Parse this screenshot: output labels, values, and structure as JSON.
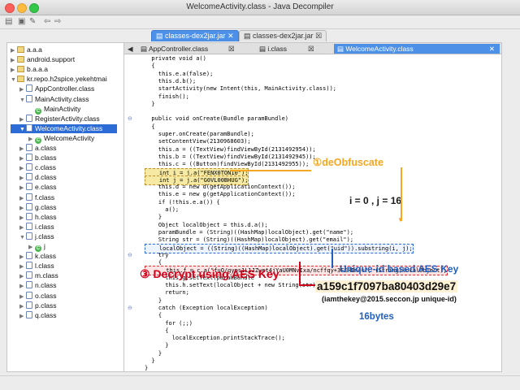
{
  "window": {
    "title": "WelcomeActivity.class - Java Decompiler"
  },
  "file_tabs": [
    {
      "label": "classes-dex2jar.jar",
      "close": "✕"
    },
    {
      "label": "classes-dex2jar.jar",
      "close": "☒"
    }
  ],
  "tree": [
    {
      "label": "a.a.a",
      "icon": "package",
      "arrow": "▶"
    },
    {
      "label": "android.support",
      "icon": "package",
      "arrow": "▶"
    },
    {
      "label": "b.a.a.a",
      "icon": "package",
      "arrow": "▶"
    },
    {
      "label": "kr.repo.h2spice.yekehtmai",
      "icon": "package",
      "arrow": "▼"
    },
    {
      "label": "AppController.class",
      "icon": "class",
      "arrow": "▶"
    },
    {
      "label": "MainActivity.class",
      "icon": "class",
      "arrow": "▼"
    },
    {
      "label": "MainActivity",
      "icon": "c",
      "arrow": ""
    },
    {
      "label": "RegisterActivity.class",
      "icon": "class",
      "arrow": "▶"
    },
    {
      "label": "WelcomeActivity.class",
      "icon": "class",
      "arrow": "▼"
    },
    {
      "label": "WelcomeActivity",
      "icon": "c",
      "arrow": "▶"
    },
    {
      "label": "a.class",
      "icon": "class",
      "arrow": "▶"
    },
    {
      "label": "b.class",
      "icon": "class",
      "arrow": "▶"
    },
    {
      "label": "c.class",
      "icon": "class",
      "arrow": "▶"
    },
    {
      "label": "d.class",
      "icon": "class",
      "arrow": "▶"
    },
    {
      "label": "e.class",
      "icon": "class",
      "arrow": "▶"
    },
    {
      "label": "f.class",
      "icon": "class",
      "arrow": "▶"
    },
    {
      "label": "g.class",
      "icon": "class",
      "arrow": "▶"
    },
    {
      "label": "h.class",
      "icon": "class",
      "arrow": "▶"
    },
    {
      "label": "i.class",
      "icon": "class",
      "arrow": "▶"
    },
    {
      "label": "j.class",
      "icon": "class",
      "arrow": "▼"
    },
    {
      "label": "j",
      "icon": "c",
      "arrow": "▶"
    },
    {
      "label": "k.class",
      "icon": "class",
      "arrow": "▶"
    },
    {
      "label": "l.class",
      "icon": "class",
      "arrow": "▶"
    },
    {
      "label": "m.class",
      "icon": "class",
      "arrow": "▶"
    },
    {
      "label": "n.class",
      "icon": "class",
      "arrow": "▶"
    },
    {
      "label": "o.class",
      "icon": "class",
      "arrow": "▶"
    },
    {
      "label": "p.class",
      "icon": "class",
      "arrow": "▶"
    },
    {
      "label": "q.class",
      "icon": "class",
      "arrow": "▶"
    }
  ],
  "editor_tabs": [
    {
      "label": "AppController.class",
      "close": "☒"
    },
    {
      "label": "i.class",
      "close": "☒"
    },
    {
      "label": "WelcomeActivity.class",
      "close": "✕"
    }
  ],
  "code": [
    "  private void a()",
    "  {",
    "    this.e.a(false);",
    "    this.d.b();",
    "    startActivity(new Intent(this, MainActivity.class));",
    "    finish();",
    "  }",
    "",
    "  public void onCreate(Bundle paramBundle)",
    "  {",
    "    super.onCreate(paramBundle);",
    "    setContentView(2130968603);",
    "    this.a = ((TextView)findViewById(2131492954));",
    "    this.b = ((TextView)findViewById(2131492945));",
    "    this.c = ((Button)findViewById(2131492955));",
    "    int i = j.a(\"FENX0TON10\");",
    "    int j = j.a(\"G0VL00BHUG\");",
    "    this.d = new d(getApplicationContext());",
    "    this.e = new g(getApplicationContext());",
    "    if (!this.e.a()) {",
    "      a();",
    "    }",
    "    Object localObject = this.d.a();",
    "    paramBundle = (String)((HashMap)localObject).get(\"name\");",
    "    String str = (String)((HashMap)localObject).get(\"email\");",
    "    localObject = ((String)((HashMap)localObject).get(\"uid\")).substring(i, j);",
    "    try",
    "    {",
    "      this.f = c.a(\"fuO/gyps1L1JZwet4jYaU0MNvIxa/ncffqy+3FEHIn4=\", (String)localObject);",
    "      this.g.setText(paramBundle",
    "      this.h.setText(localObject + new String(str));",
    "      return;",
    "    }",
    "    catch (Exception localException)",
    "    {",
    "      for (;;)",
    "      {",
    "        localException.printStackTrace();",
    "      }",
    "    }",
    "  }",
    "}"
  ],
  "annotations": {
    "step1": "①deObfuscate",
    "indices": "i = 0 , j = 16",
    "unique_key": "Unique-id based AES Key",
    "step3": "③ Decrypt using AES Key",
    "key_value": "a159c1f7097ba80403d29e7",
    "key_note": "(iamthekey@2015.seccon.jp unique-id)",
    "bytes": "16bytes"
  },
  "colors": {
    "accent": "#4d90e8",
    "orange": "#f5a623",
    "red": "#d0021b",
    "blue": "#1f5fbf"
  }
}
